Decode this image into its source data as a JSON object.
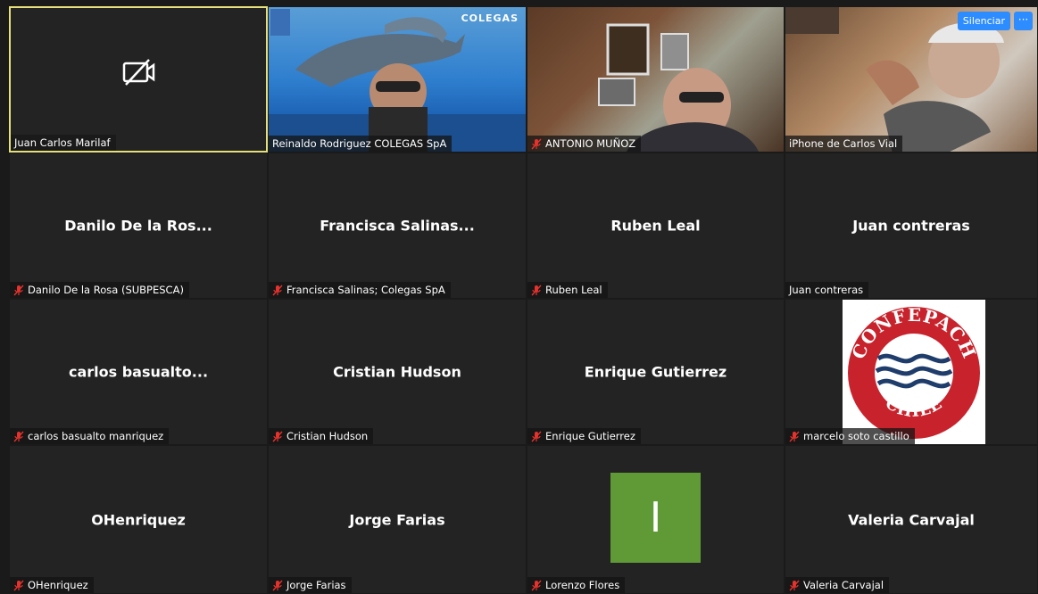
{
  "controls": {
    "mute_label": "Silenciar",
    "more_label": "···"
  },
  "tiles": [
    {
      "label": "Juan  Carlos Marilaf"
    },
    {
      "label": "Reinaldo Rodriguez  COLEGAS SpA",
      "overlay_text": "COLEGAS"
    },
    {
      "label": "ANTONIO MUÑOZ"
    },
    {
      "label": "iPhone de Carlos Vial"
    },
    {
      "name": "Danilo De la Ros...",
      "label": "Danilo De la Rosa (SUBPESCA)"
    },
    {
      "name": "Francisca  Salinas...",
      "label": "Francisca Salinas; Colegas SpA"
    },
    {
      "name": "Ruben Leal",
      "label": "Ruben Leal"
    },
    {
      "name": "Juan contreras",
      "label": "Juan contreras"
    },
    {
      "name": "carlos basualto...",
      "label": "carlos basualto manriquez"
    },
    {
      "name": "Cristian Hudson",
      "label": "Cristian Hudson"
    },
    {
      "name": "Enrique Gutierrez",
      "label": "Enrique Gutierrez"
    },
    {
      "label": "marcelo soto castillo",
      "logo_top": "CONFEPACH",
      "logo_bottom": "CHILE"
    },
    {
      "name": "OHenriquez",
      "label": "OHenriquez"
    },
    {
      "name": "Jorge Farias",
      "label": "Jorge Farias"
    },
    {
      "label": "Lorenzo Flores",
      "initial": "I"
    },
    {
      "name": "Valeria Carvajal",
      "label": "Valeria Carvajal"
    }
  ],
  "colors": {
    "active_border": "#e6e07a",
    "accent": "#2d8cff",
    "muted": "#e5322d",
    "avatar_green": "#5f9a37"
  },
  "icons": {
    "muted": "mic-muted-icon",
    "no_video": "video-off-icon"
  }
}
